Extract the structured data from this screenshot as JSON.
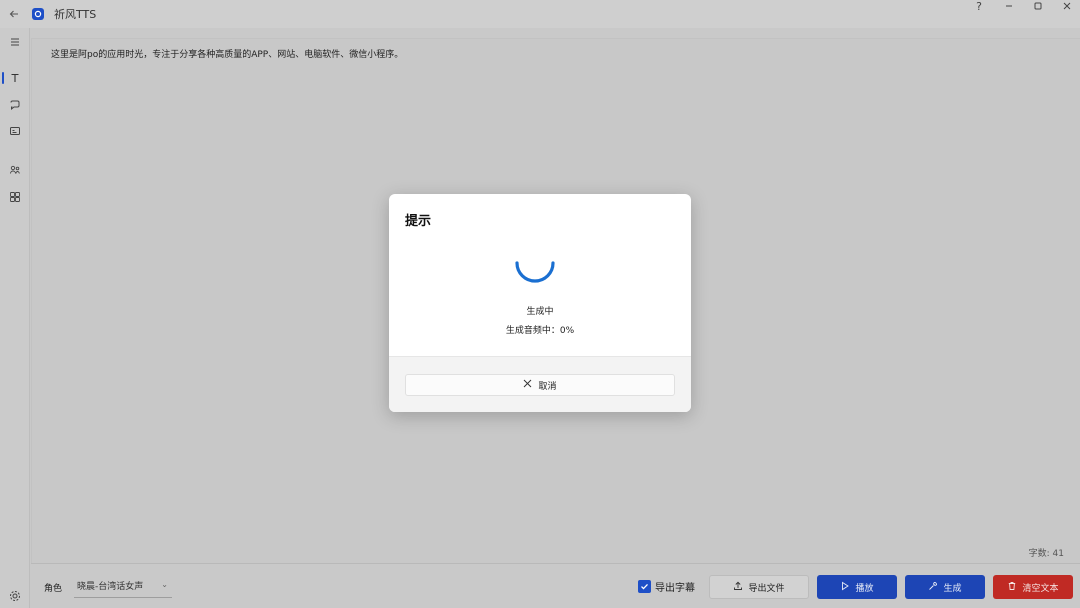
{
  "window": {
    "title": "祈风TTS",
    "help_glyph": "?",
    "minimize_glyph": "—",
    "close_glyph": "✕"
  },
  "sidebar": {
    "items": [
      {
        "name": "menu-icon"
      },
      {
        "name": "text-icon",
        "active": true
      },
      {
        "name": "chat-icon"
      },
      {
        "name": "subtitle-icon"
      },
      {
        "name": "people-icon"
      },
      {
        "name": "apps-icon"
      }
    ]
  },
  "editor": {
    "text": "这里是阿po的应用时光，专注于分享各种高质量的APP、网站、电脑软件、微信小程序。",
    "char_count": "字数: 41"
  },
  "bottom_bar": {
    "role_label": "角色",
    "role_value": "晓晨-台湾话女声",
    "export_subtitle_label": "导出字幕",
    "export_subtitle_checked": true,
    "export_file_label": "导出文件",
    "play_label": "播放",
    "generate_label": "生成",
    "clear_label": "清空文本"
  },
  "dialog": {
    "title": "提示",
    "status_1": "生成中",
    "status_2": "生成音频中：0%",
    "progress_percent": 0,
    "cancel_label": "取消"
  },
  "colors": {
    "accent_blue": "#1d45b5",
    "danger_red": "#c02a24",
    "spinner_blue": "#1a6fd1"
  }
}
